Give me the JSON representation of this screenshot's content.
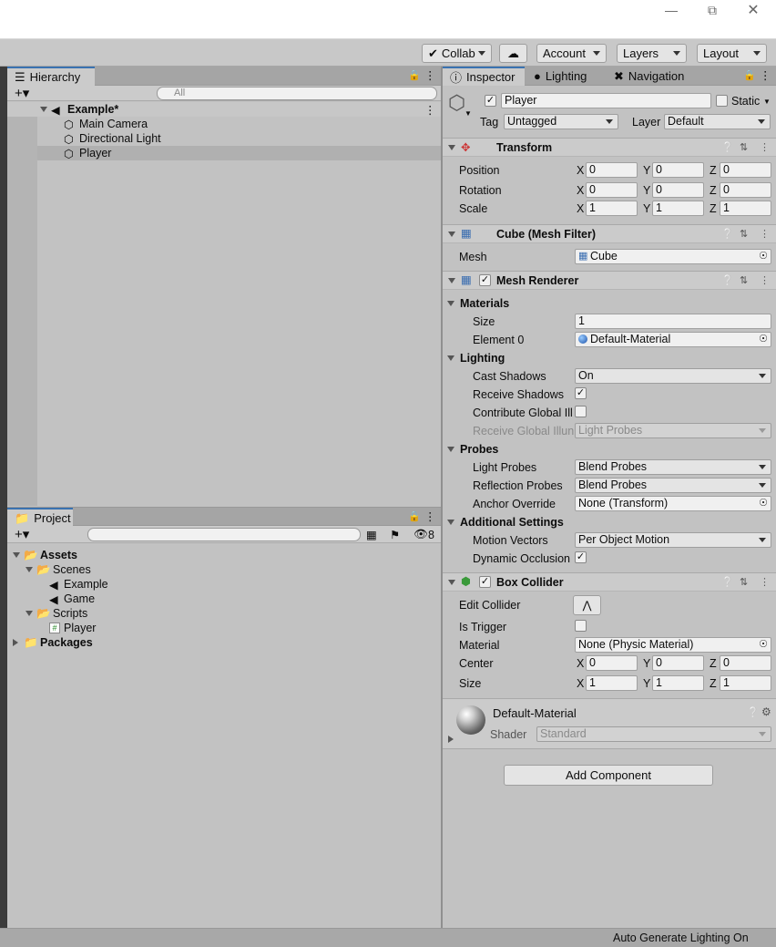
{
  "toolbar": {
    "collab": "Collab",
    "account": "Account",
    "layers": "Layers",
    "layout": "Layout"
  },
  "hierarchy": {
    "tab": "Hierarchy",
    "search_placeholder": "All",
    "scene": "Example*",
    "items": [
      "Main Camera",
      "Directional Light",
      "Player"
    ]
  },
  "project": {
    "tab": "Project",
    "hidden_count": "8",
    "tree": {
      "assets": "Assets",
      "scenes": "Scenes",
      "scene_example": "Example",
      "scene_game": "Game",
      "scripts": "Scripts",
      "script_player": "Player",
      "packages": "Packages"
    }
  },
  "inspector": {
    "tabs": [
      "Inspector",
      "Lighting",
      "Navigation"
    ],
    "object_name": "Player",
    "static_label": "Static",
    "tag_label": "Tag",
    "tag_value": "Untagged",
    "layer_label": "Layer",
    "layer_value": "Default",
    "transform": {
      "title": "Transform",
      "position_label": "Position",
      "rotation_label": "Rotation",
      "scale_label": "Scale",
      "position": [
        "0",
        "0",
        "0"
      ],
      "rotation": [
        "0",
        "0",
        "0"
      ],
      "scale": [
        "1",
        "1",
        "1"
      ]
    },
    "axis": [
      "X",
      "Y",
      "Z"
    ],
    "mesh_filter": {
      "title": "Cube (Mesh Filter)",
      "mesh_label": "Mesh",
      "mesh_value": "Cube"
    },
    "mesh_renderer": {
      "title": "Mesh Renderer",
      "materials": "Materials",
      "size_label": "Size",
      "size_value": "1",
      "element0_label": "Element 0",
      "element0_value": "Default-Material",
      "lighting": "Lighting",
      "cast_shadows_label": "Cast Shadows",
      "cast_shadows_value": "On",
      "receive_shadows_label": "Receive Shadows",
      "contribute_gi_label": "Contribute Global Ill",
      "receive_gi_label": "Receive Global Illun",
      "receive_gi_value": "Light Probes",
      "probes": "Probes",
      "light_probes_label": "Light Probes",
      "light_probes_value": "Blend Probes",
      "reflection_probes_label": "Reflection Probes",
      "reflection_probes_value": "Blend Probes",
      "anchor_override_label": "Anchor Override",
      "anchor_override_value": "None (Transform)",
      "additional": "Additional Settings",
      "motion_vectors_label": "Motion Vectors",
      "motion_vectors_value": "Per Object Motion",
      "dynamic_occlusion_label": "Dynamic Occlusion"
    },
    "box_collider": {
      "title": "Box Collider",
      "edit_collider_label": "Edit Collider",
      "is_trigger_label": "Is Trigger",
      "material_label": "Material",
      "material_value": "None (Physic Material)",
      "center_label": "Center",
      "size_label": "Size",
      "center": [
        "0",
        "0",
        "0"
      ],
      "size": [
        "1",
        "1",
        "1"
      ]
    },
    "material": {
      "name": "Default-Material",
      "shader_label": "Shader",
      "shader_value": "Standard"
    },
    "add_component": "Add Component"
  },
  "status": {
    "text": "Auto Generate Lighting On"
  }
}
